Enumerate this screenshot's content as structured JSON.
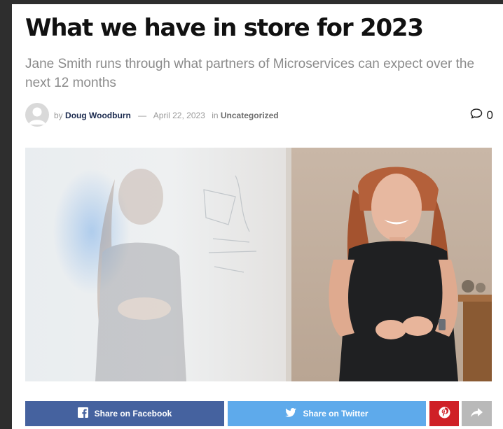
{
  "article": {
    "title": "What we have in store for 2023",
    "subtitle": "Jane Smith runs through what partners of Microservices can expect over the next 12 months"
  },
  "meta": {
    "by_prefix": "by",
    "author": "Doug Woodburn",
    "separator": "—",
    "date": "April 22, 2023",
    "in_prefix": "in",
    "category": "Uncategorized",
    "comment_count": "0"
  },
  "share": {
    "facebook_label": "Share on Facebook",
    "twitter_label": "Share on Twitter"
  },
  "icons": {
    "avatar": "user-avatar-icon",
    "comments": "comment-bubble-icon",
    "facebook": "facebook-icon",
    "twitter": "twitter-icon",
    "pinterest": "pinterest-icon",
    "more": "share-arrow-icon"
  },
  "colors": {
    "facebook": "#45629f",
    "twitter": "#5eaaeb",
    "pinterest": "#cf2026",
    "more": "#b9b9b9",
    "author": "#1c2b4f"
  }
}
